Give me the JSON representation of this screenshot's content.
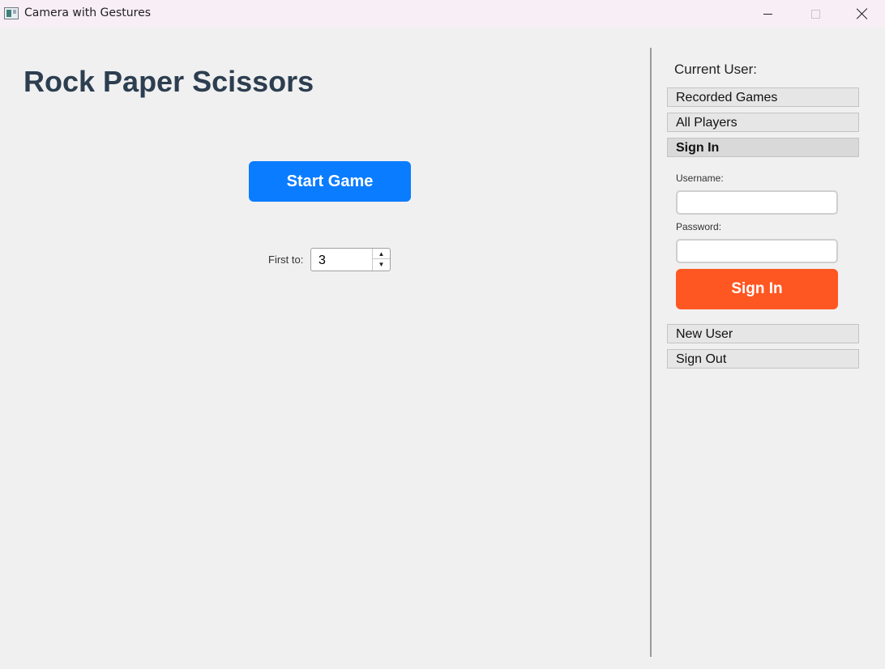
{
  "window": {
    "title": "Camera with Gestures",
    "controls": [
      "minimize",
      "maximize",
      "close"
    ]
  },
  "main": {
    "title": "Rock Paper Scissors",
    "start_button": "Start Game",
    "first_to_label": "First to:",
    "first_to_value": "3"
  },
  "sidebar": {
    "current_user_label": "Current User:",
    "items": [
      {
        "label": "Recorded Games"
      },
      {
        "label": "All Players"
      },
      {
        "label": "Sign In"
      }
    ],
    "signin_form": {
      "username_label": "Username:",
      "username_value": "",
      "password_label": "Password:",
      "password_value": "",
      "submit_label": "Sign In"
    },
    "bottom_items": [
      {
        "label": "New User"
      },
      {
        "label": "Sign Out"
      }
    ]
  },
  "colors": {
    "start_button": "#0a7cff",
    "signin_button": "#ff5722",
    "title_text": "#2c3e50",
    "background": "#f0f0f0"
  }
}
